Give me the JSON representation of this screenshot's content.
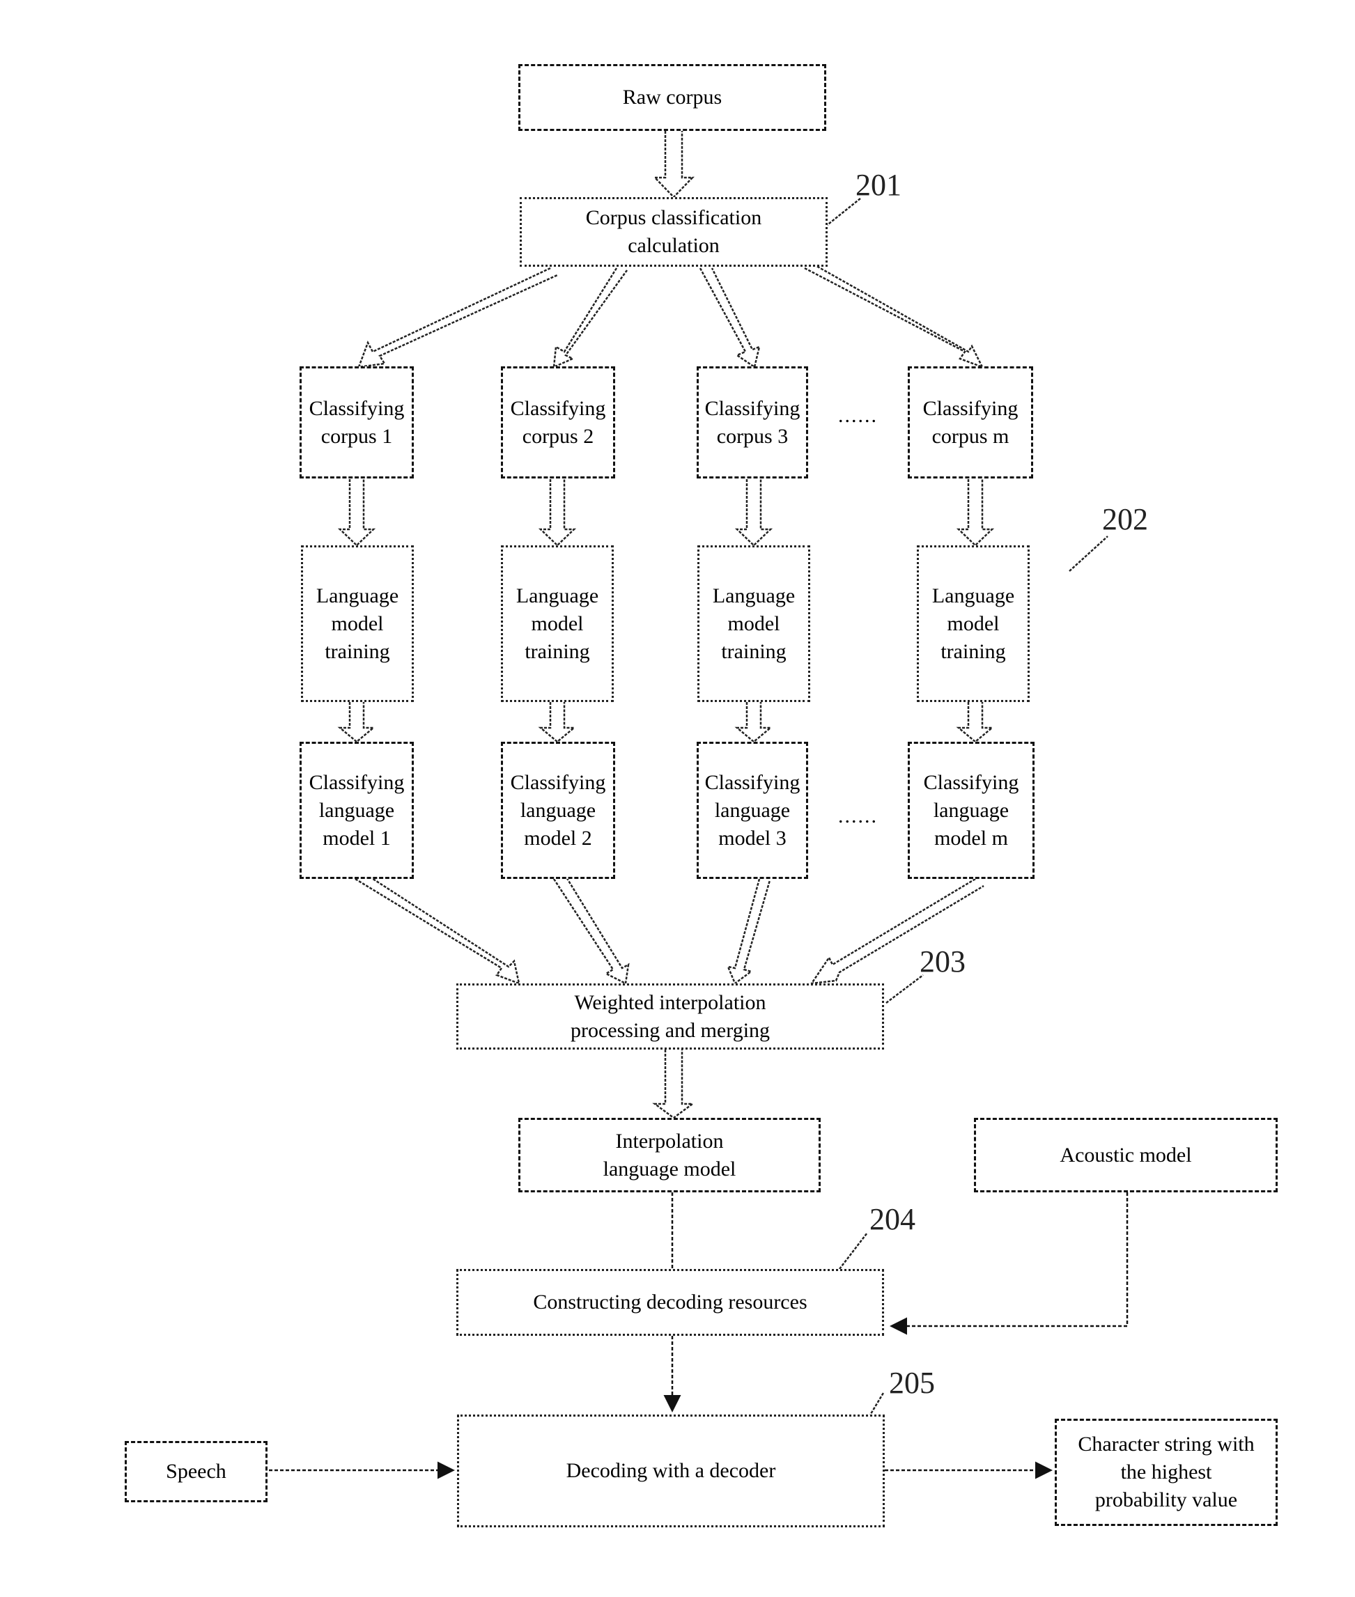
{
  "diagram": {
    "nodes": {
      "raw_corpus": "Raw corpus",
      "corpus_classification": "Corpus classification\ncalculation",
      "classifying_corpus": [
        "Classifying\ncorpus 1",
        "Classifying\ncorpus 2",
        "Classifying\ncorpus 3",
        "Classifying\ncorpus m"
      ],
      "lm_training": [
        "Language\nmodel\ntraining",
        "Language\nmodel\ntraining",
        "Language\nmodel\ntraining",
        "Language\nmodel\ntraining"
      ],
      "classifying_lm": [
        "Classifying\nlanguage\nmodel 1",
        "Classifying\nlanguage\nmodel 2",
        "Classifying\nlanguage\nmodel 3",
        "Classifying\nlanguage\nmodel m"
      ],
      "weighted_interpolation": "Weighted interpolation\nprocessing and merging",
      "interpolation_lm": "Interpolation\nlanguage model",
      "acoustic_model": "Acoustic model",
      "constructing_decoding": "Constructing decoding resources",
      "decoding": "Decoding with a decoder",
      "speech": "Speech",
      "output": "Character string with\nthe highest\nprobability value"
    },
    "ellipsis": "......",
    "refs": {
      "r201": "201",
      "r202": "202",
      "r203": "203",
      "r204": "204",
      "r205": "205"
    }
  }
}
